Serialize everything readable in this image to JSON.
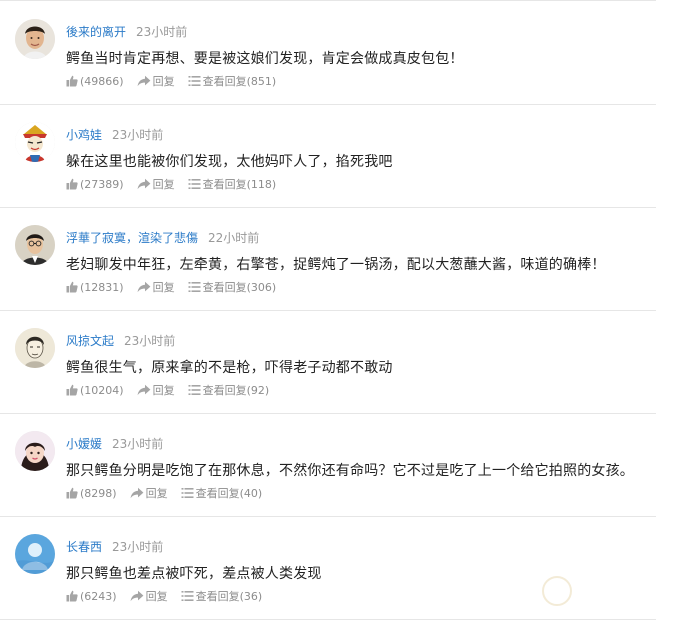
{
  "comments": [
    {
      "user": "後来的离开",
      "time": "23小时前",
      "text": "鳄鱼当时肯定再想、要是被这娘们发现，肯定会做成真皮包包！",
      "likes": "(49866)",
      "reply_label": "回复",
      "view_label": "查看回复",
      "view_count": "(851)",
      "avatar": "young-man-avatar"
    },
    {
      "user": "小鸡娃",
      "time": "23小时前",
      "text": "躲在这里也能被你们发现，太他妈吓人了，掐死我吧",
      "likes": "(27389)",
      "reply_label": "回复",
      "view_label": "查看回复",
      "view_count": "(118)",
      "avatar": "opera-mask-avatar"
    },
    {
      "user": "浮華了寂寞，渲染了悲傷",
      "time": "22小时前",
      "text": "老妇聊发中年狂，左牵黄，右擎苍，捉鳄炖了一锅汤，配以大葱蘸大酱，味道的确棒！",
      "likes": "(12831)",
      "reply_label": "回复",
      "view_label": "查看回复",
      "view_count": "(306)",
      "avatar": "suit-man-avatar"
    },
    {
      "user": "风掠文起",
      "time": "23小时前",
      "text": "鳄鱼很生气，原来拿的不是枪，吓得老子动都不敢动",
      "likes": "(10204)",
      "reply_label": "回复",
      "view_label": "查看回复",
      "view_count": "(92)",
      "avatar": "sketch-portrait-avatar"
    },
    {
      "user": "小嫒媛",
      "time": "23小时前",
      "text": "那只鳄鱼分明是吃饱了在那休息，不然你还有命吗？它不过是吃了上一个给它拍照的女孩。",
      "likes": "(8298)",
      "reply_label": "回复",
      "view_label": "查看回复",
      "view_count": "(40)",
      "avatar": "girl-avatar"
    },
    {
      "user": "长春西",
      "time": "23小时前",
      "text": "那只鳄鱼也差点被吓死，差点被人类发现",
      "likes": "(6243)",
      "reply_label": "回复",
      "view_label": "查看回复",
      "view_count": "(36)",
      "avatar": "default-blue-avatar"
    }
  ],
  "icons": {
    "like": "thumbs-up-icon",
    "reply": "reply-arrow-icon",
    "view": "list-icon"
  },
  "colors": {
    "username": "#2b7bc8",
    "meta": "#999999",
    "action": "#8c8c8c",
    "divider": "#e6e6e6"
  }
}
